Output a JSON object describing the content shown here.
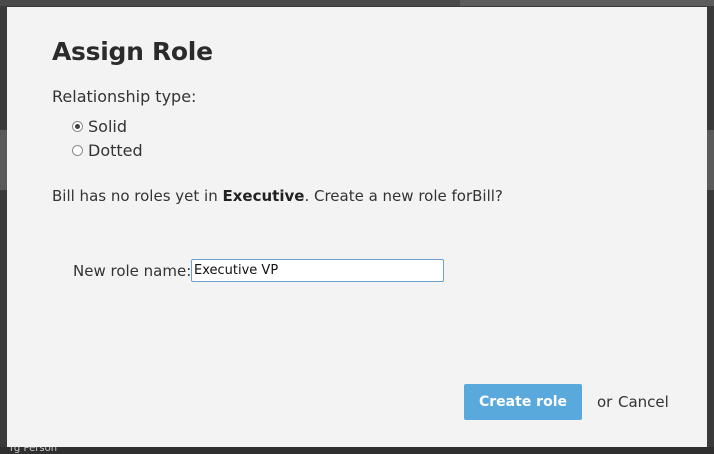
{
  "background": {
    "partial_text": "rg Person"
  },
  "dialog": {
    "title": "Assign Role",
    "relationship_label": "Relationship type:",
    "relationship_options": [
      {
        "label": "Solid",
        "selected": true
      },
      {
        "label": "Dotted",
        "selected": false
      }
    ],
    "message": {
      "prefix": "Bill has no roles yet in",
      "group": "Executive",
      "suffix": ". Create a new role forBill?"
    },
    "new_role": {
      "label": "New role name:",
      "value": "Executive VP",
      "placeholder": ""
    },
    "create_button": "Create role",
    "or_text": "or",
    "cancel_link": "Cancel"
  },
  "colors": {
    "dialog_bg": "#f3f3f3",
    "primary_button": "#5aa9dc",
    "input_focus_border": "#6f9fd0",
    "backdrop": "#3a3a3a"
  }
}
